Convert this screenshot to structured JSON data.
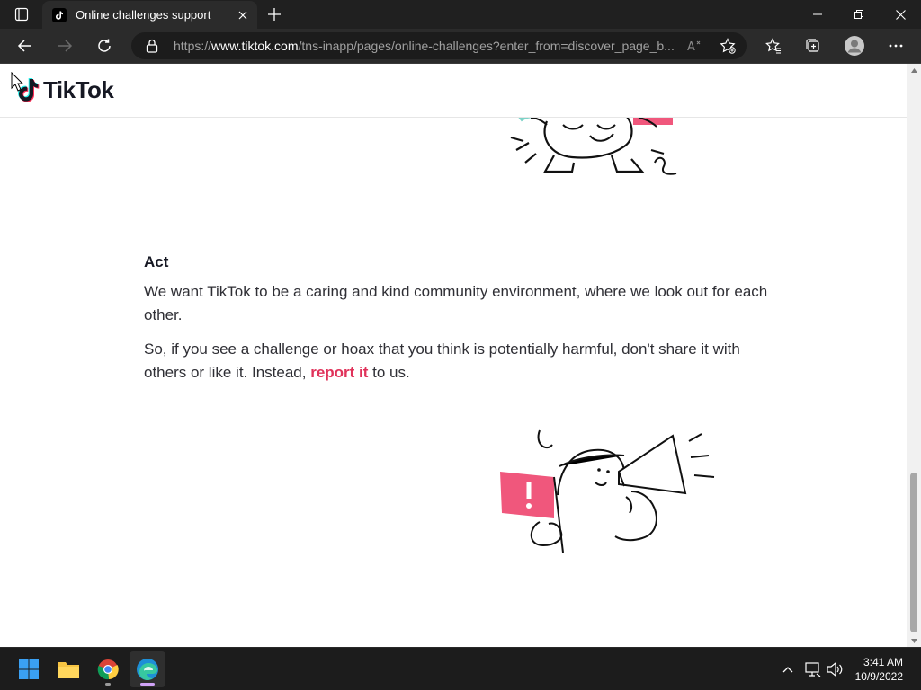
{
  "browser": {
    "tab": {
      "title": "Online challenges support"
    },
    "url": {
      "prefix": "https://",
      "host": "www.tiktok.com",
      "path": "/tns-inapp/pages/online-challenges?enter_from=discover_page_b..."
    }
  },
  "page": {
    "logo_text": "TikTok",
    "section_heading": "Act",
    "paragraph1": "We want TikTok to be a caring and kind community environment, where we look out for each other.",
    "paragraph2_before": "So, if you see a challenge or hoax that you think is potentially harmful, don't share it with others or like it. Instead, ",
    "paragraph2_link": "report it",
    "paragraph2_after": " to us."
  },
  "taskbar": {
    "time": "3:41 AM",
    "date": "10/9/2022"
  },
  "colors": {
    "accent_pink": "#e0325a",
    "tiktok_cyan": "#25f4ee",
    "tiktok_red": "#fe2c55",
    "flag_pink": "#f0577c"
  }
}
